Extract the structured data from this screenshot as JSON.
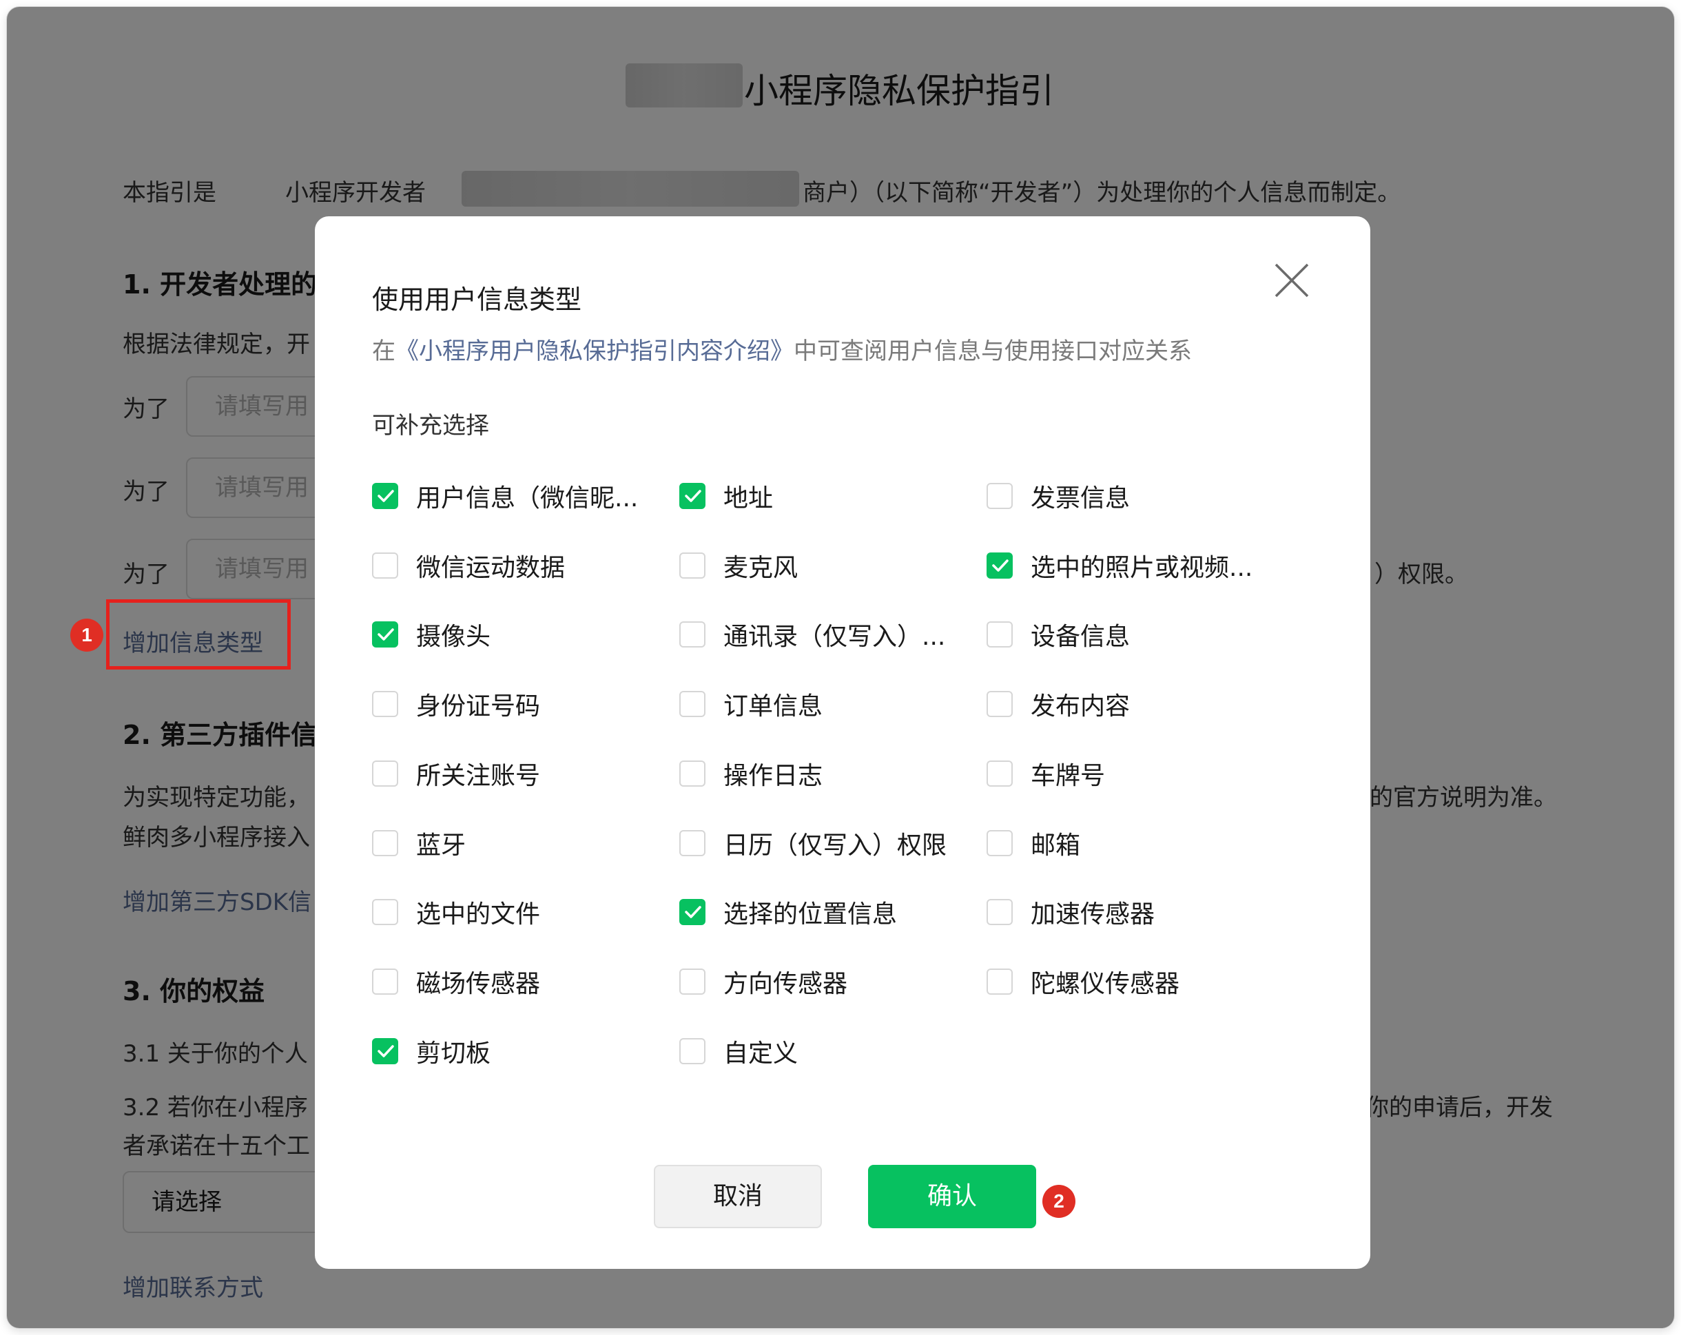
{
  "doc": {
    "title": "小程序隐私保护指引",
    "intro_start": "本指引是",
    "intro_mid": "小程序开发者",
    "intro_end": "商户）（以下简称“开发者”）为处理你的个人信息而制定。",
    "section1_title": "1.  开发者处理的",
    "section1_para": "根据法律规定，开",
    "for_label": "为了",
    "input_placeholder": "请填写用",
    "permission_tail": "）权限。",
    "add_info_type": "增加信息类型",
    "section2_title": "2.  第三方插件信",
    "section2_para1": "为实现特定功能，",
    "section2_para1_tail": "的官方说明为准。",
    "section2_para2": "鲜肉多小程序接入",
    "add_sdk": "增加第三方SDK信",
    "section3_title": "3.  你的权益",
    "s31": "3.1   关于你的个人",
    "s32": "3.2   若你在小程序",
    "s32_tail": "你的申请后，开发",
    "s32_line2": "者承诺在十五个工",
    "select_placeholder": "请选择",
    "add_contact": "增加联系方式"
  },
  "modal": {
    "title": "使用用户信息类型",
    "sub_prefix": "在",
    "sub_link": "《小程序用户隐私保护指引内容介绍》",
    "sub_suffix": "中可查阅用户信息与使用接口对应关系",
    "section_label": "可补充选择",
    "options": [
      {
        "label": "用户信息（微信昵...",
        "checked": true
      },
      {
        "label": "地址",
        "checked": true
      },
      {
        "label": "发票信息",
        "checked": false
      },
      {
        "label": "微信运动数据",
        "checked": false
      },
      {
        "label": "麦克风",
        "checked": false
      },
      {
        "label": "选中的照片或视频...",
        "checked": true
      },
      {
        "label": "摄像头",
        "checked": true
      },
      {
        "label": "通讯录（仅写入）...",
        "checked": false
      },
      {
        "label": "设备信息",
        "checked": false
      },
      {
        "label": "身份证号码",
        "checked": false
      },
      {
        "label": "订单信息",
        "checked": false
      },
      {
        "label": "发布内容",
        "checked": false
      },
      {
        "label": "所关注账号",
        "checked": false
      },
      {
        "label": "操作日志",
        "checked": false
      },
      {
        "label": "车牌号",
        "checked": false
      },
      {
        "label": "蓝牙",
        "checked": false
      },
      {
        "label": "日历（仅写入）权限",
        "checked": false
      },
      {
        "label": "邮箱",
        "checked": false
      },
      {
        "label": "选中的文件",
        "checked": false
      },
      {
        "label": "选择的位置信息",
        "checked": true
      },
      {
        "label": "加速传感器",
        "checked": false
      },
      {
        "label": "磁场传感器",
        "checked": false
      },
      {
        "label": "方向传感器",
        "checked": false
      },
      {
        "label": "陀螺仪传感器",
        "checked": false
      },
      {
        "label": "剪切板",
        "checked": true
      },
      {
        "label": "自定义",
        "checked": false
      }
    ],
    "cancel_label": "取消",
    "confirm_label": "确认"
  },
  "annotations": {
    "badge_1": "1",
    "badge_2": "2"
  },
  "colors": {
    "accent_green": "#07c160",
    "link_blue": "#576b95",
    "annotation_red": "#e5211d"
  }
}
